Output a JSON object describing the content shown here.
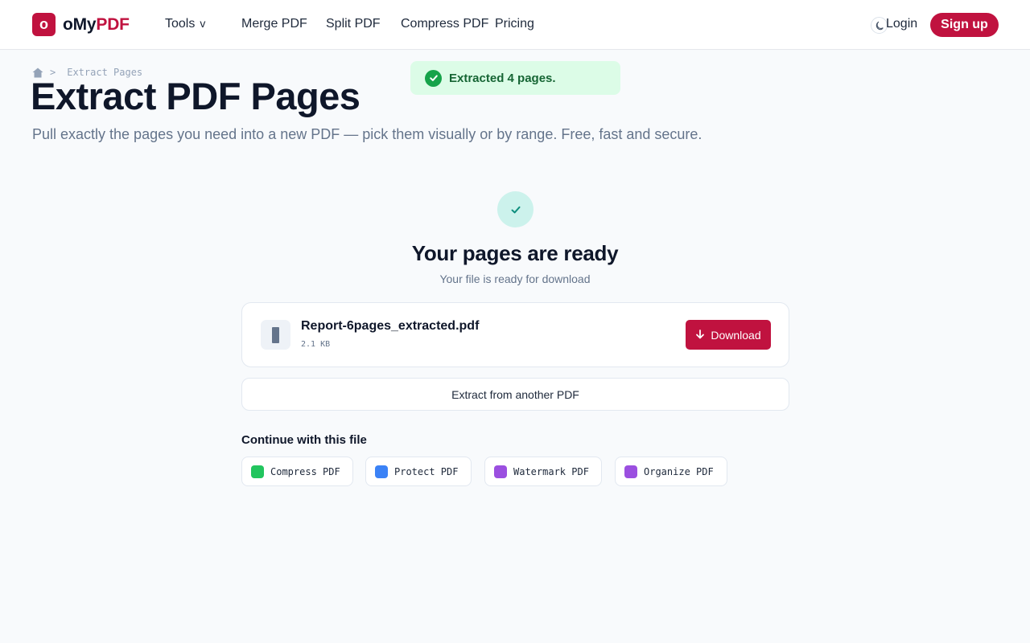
{
  "brand": {
    "mark": "o",
    "name_part1": "oMy",
    "name_part2": "PDF",
    "accent": "#c0123f"
  },
  "nav": {
    "tools_label": "Tools",
    "tools_caret": "v",
    "merge_label": "Merge PDF",
    "split_label": "Split PDF",
    "compress_label": "Compress PDF",
    "pricing_label": "Pricing"
  },
  "header": {
    "theme_icon": "moon-icon",
    "login_label": "Login",
    "signup_label": "Sign up"
  },
  "breadcrumb": {
    "home_icon": "home-icon",
    "separator": ">",
    "current": "Extract Pages"
  },
  "hero": {
    "title": "Extract PDF Pages",
    "subtitle": "Pull exactly the pages you need into a new PDF — pick them visually or by range. Free, fast and secure."
  },
  "toast": {
    "icon": "check-circle-icon",
    "message": "Extracted 4 pages.",
    "color": "#16a34a"
  },
  "result": {
    "icon": "check-icon",
    "title": "Your pages are ready",
    "subtitle": "Your file is ready for download",
    "file": {
      "icon": "file-icon",
      "name": "Report-6pages_extracted.pdf",
      "size": "2.1 KB"
    },
    "download_label": "Download",
    "another_label": "Extract from another PDF"
  },
  "continue": {
    "title": "Continue with this file",
    "tools": [
      {
        "label": "Compress PDF",
        "color": "#22c55e"
      },
      {
        "label": "Protect PDF",
        "color": "#3b82f6"
      },
      {
        "label": "Watermark PDF",
        "color": "#9b4fe0"
      },
      {
        "label": "Organize PDF",
        "color": "#9b4fe0"
      }
    ]
  }
}
